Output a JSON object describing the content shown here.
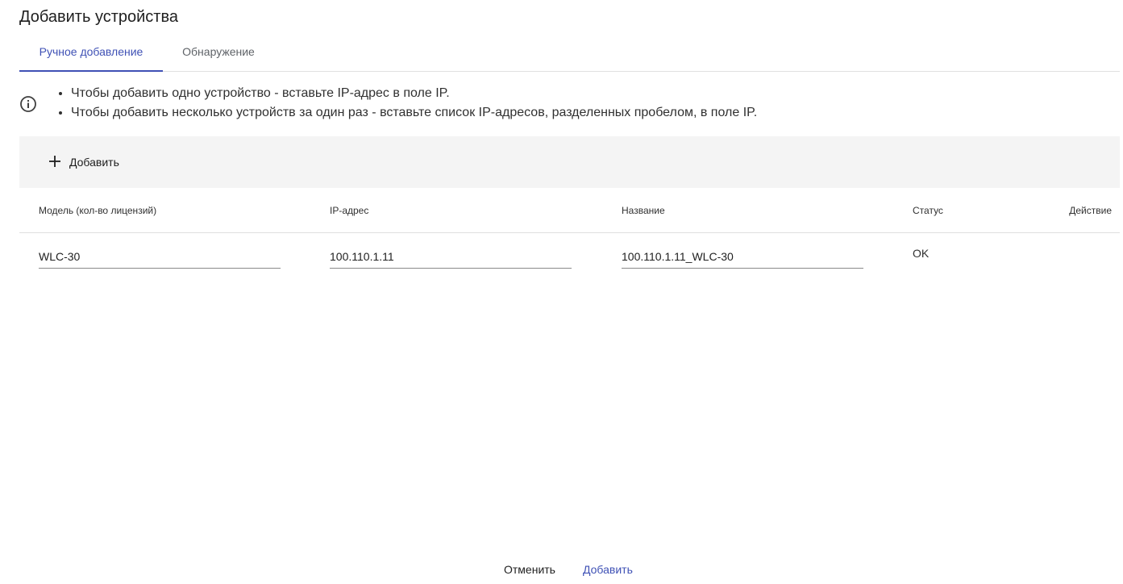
{
  "dialog": {
    "title": "Добавить устройства"
  },
  "tabs": [
    {
      "label": "Ручное добавление",
      "active": true
    },
    {
      "label": "Обнаружение",
      "active": false
    }
  ],
  "info": {
    "icon": "info-icon",
    "lines": [
      "Чтобы добавить одно устройство - вставьте IP-адрес в поле IP.",
      "Чтобы добавить несколько устройств за один раз - вставьте список IP-адресов, разделенных пробелом, в поле IP."
    ]
  },
  "toolbar": {
    "add_label": "Добавить",
    "add_icon": "plus-icon"
  },
  "table": {
    "columns": [
      "Модель (кол-во лицензий)",
      "IP-адрес",
      "Название",
      "Статус",
      "Действие"
    ],
    "rows": [
      {
        "model": "WLC-30",
        "ip": "100.110.1.11",
        "name": "100.110.1.11_WLC-30",
        "status": "OK"
      }
    ]
  },
  "footer": {
    "cancel_label": "Отменить",
    "confirm_label": "Добавить"
  },
  "colors": {
    "accent": "#3f51b5",
    "toolbar_bg": "#f4f4f4"
  }
}
